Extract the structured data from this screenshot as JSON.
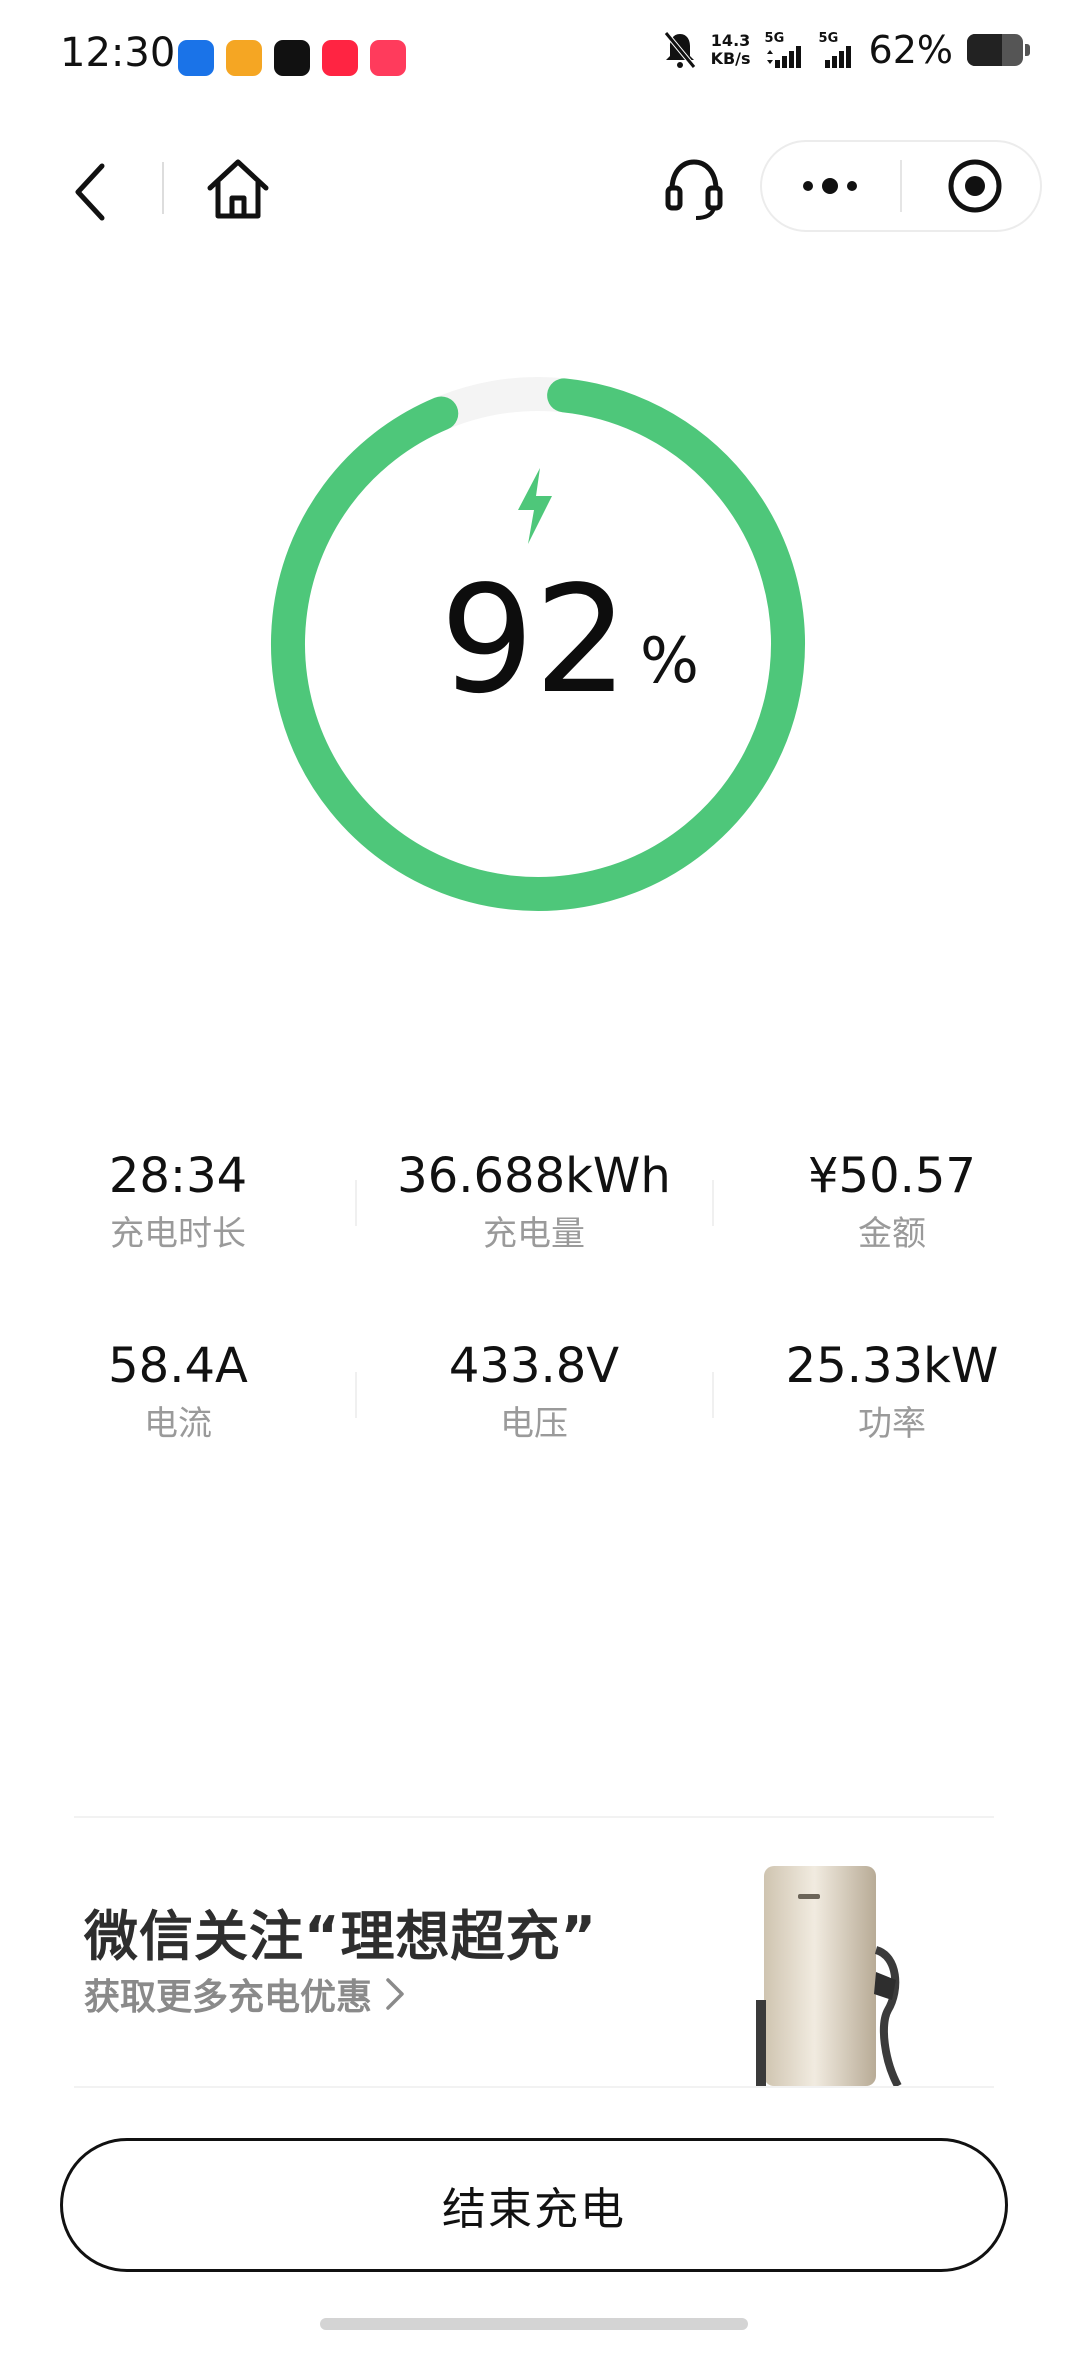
{
  "status_bar": {
    "time": "12:30",
    "net_speed_value": "14.3",
    "net_speed_unit": "KB/s",
    "sim1_label": "5G",
    "sim2_label": "5G",
    "battery_percent_text": "62%",
    "battery_level": 0.62,
    "notifications": [
      {
        "name": "chat-app-icon",
        "color": "#1a73e8"
      },
      {
        "name": "weibo-icon",
        "color": "#f5a623"
      },
      {
        "name": "tiktok-icon",
        "color": "#111111"
      },
      {
        "name": "xiaohongshu-icon",
        "color": "#ff2442"
      },
      {
        "name": "app-red-icon",
        "color": "#ff3b5c"
      }
    ]
  },
  "nav": {
    "back_icon": "chevron-left-icon",
    "home_icon": "home-icon",
    "headset_icon": "headset-icon",
    "more_icon": "more-dots-icon",
    "target_icon": "target-icon"
  },
  "charging": {
    "percent_value": "92",
    "percent_sign": "%",
    "level": 0.92,
    "ring_color": "#4ec77a",
    "ring_track_color": "#f4f4f4"
  },
  "stats": [
    {
      "value": "28:34",
      "label": "充电时长"
    },
    {
      "value": "36.688kWh",
      "label": "充电量"
    },
    {
      "value": "¥50.57",
      "label": "金额"
    },
    {
      "value": "58.4A",
      "label": "电流"
    },
    {
      "value": "433.8V",
      "label": "电压"
    },
    {
      "value": "25.33kW",
      "label": "功率"
    }
  ],
  "banner": {
    "title": "微信关注“理想超充”",
    "subtitle": "获取更多充电优惠",
    "chevron_icon": "chevron-right-icon"
  },
  "end_button": {
    "label": "结束充电"
  }
}
